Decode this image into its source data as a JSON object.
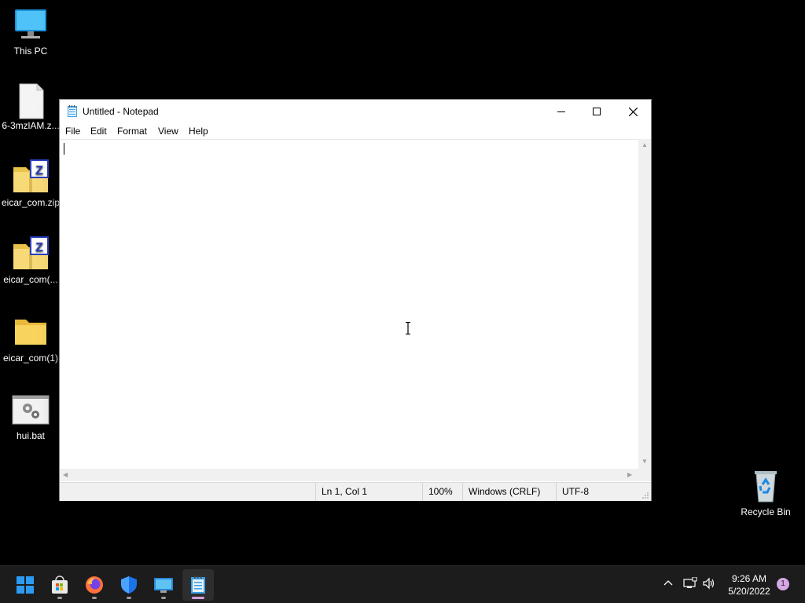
{
  "desktop": {
    "icons": [
      {
        "label": "This PC",
        "icon": "monitor-icon"
      },
      {
        "label": "6-3mzlAM.z...",
        "icon": "blank-file-icon"
      },
      {
        "label": "eicar_com.zip",
        "icon": "zip-folder-icon"
      },
      {
        "label": "eicar_com(...",
        "icon": "zip-folder-icon"
      },
      {
        "label": "eicar_com(1)",
        "icon": "folder-icon"
      },
      {
        "label": "hui.bat",
        "icon": "batch-file-icon"
      },
      {
        "label": "Recycle Bin",
        "icon": "recycle-bin-icon"
      }
    ]
  },
  "window": {
    "title": "Untitled - Notepad",
    "menu": [
      "File",
      "Edit",
      "Format",
      "View",
      "Help"
    ],
    "content": "",
    "status": {
      "position": "Ln 1, Col 1",
      "zoom": "100%",
      "line_ending": "Windows (CRLF)",
      "encoding": "UTF-8"
    }
  },
  "taskbar": {
    "apps": [
      "start-icon",
      "store-icon",
      "firefox-icon",
      "defender-icon",
      "remote-desktop-icon",
      "notepad-icon"
    ],
    "time": "9:26 AM",
    "date": "5/20/2022",
    "notification_count": "1"
  },
  "colors": {
    "desktop": "#000000",
    "taskbar": "#1c1c1c",
    "accent": "#0078d4",
    "folder": "#f8d35e"
  }
}
